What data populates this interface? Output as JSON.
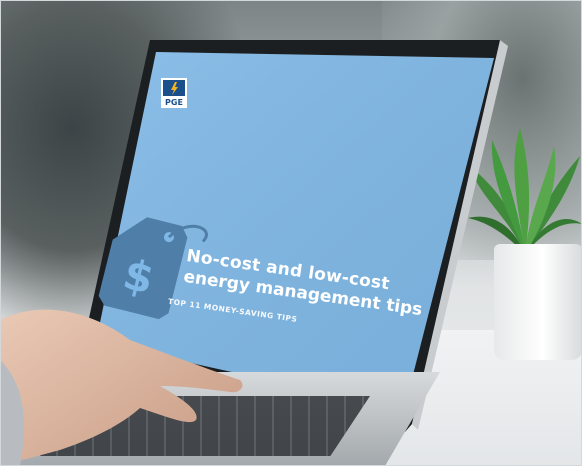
{
  "screen": {
    "logo_text": "PGE",
    "headline_line1": "No-cost and low-cost",
    "headline_line2": "energy management tips",
    "subtitle": "TOP 11 MONEY-SAVING TIPS",
    "price_tag_symbol": "$",
    "background_color": "#7fb8e6",
    "tag_color": "#4f7ea8"
  },
  "scene": {
    "plant_color": "#3d8a3a",
    "pot_color": "#f4f5f6"
  }
}
